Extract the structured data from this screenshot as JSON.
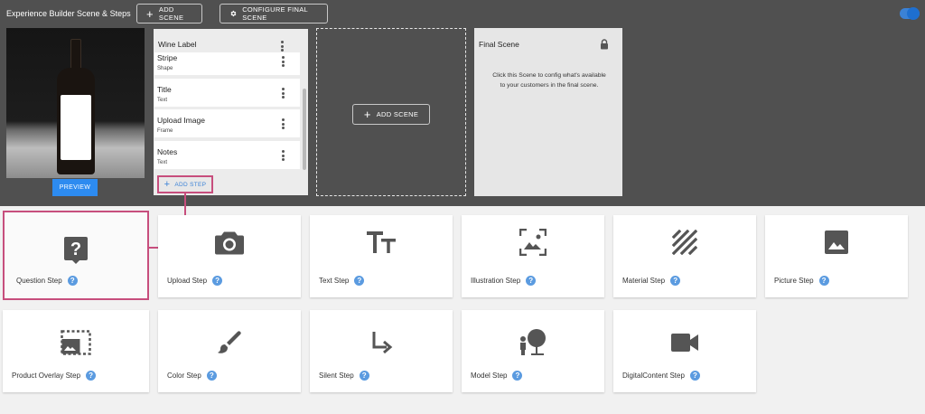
{
  "header": {
    "title": "Experience Builder Scene & Steps",
    "add_scene_label": "ADD SCENE",
    "configure_final_label": "CONFIGURE FINAL SCENE",
    "toggle_on": true
  },
  "preview": {
    "button_label": "PREVIEW"
  },
  "scene": {
    "title": "Wine Label",
    "steps": [
      {
        "name": "Stripe",
        "type": "Shape"
      },
      {
        "name": "Title",
        "type": "Text"
      },
      {
        "name": "Upload Image",
        "type": "Frame"
      },
      {
        "name": "Notes",
        "type": "Text"
      }
    ],
    "add_step_label": "ADD STEP"
  },
  "add_scene_card": {
    "label": "ADD SCENE"
  },
  "final_scene": {
    "title": "Final Scene",
    "description": "Click this Scene to config what's available to your customers in the final scene."
  },
  "step_types": [
    {
      "label": "Question Step",
      "icon": "question-icon"
    },
    {
      "label": "Upload Step",
      "icon": "camera-icon"
    },
    {
      "label": "Text Step",
      "icon": "text-icon"
    },
    {
      "label": "Illustration Step",
      "icon": "illustration-icon"
    },
    {
      "label": "Material Step",
      "icon": "texture-icon"
    },
    {
      "label": "Picture Step",
      "icon": "image-icon"
    },
    {
      "label": "Product Overlay Step",
      "icon": "overlay-icon"
    },
    {
      "label": "Color Step",
      "icon": "brush-icon"
    },
    {
      "label": "Silent Step",
      "icon": "arrow-turn-icon"
    },
    {
      "label": "Model Step",
      "icon": "model-icon"
    },
    {
      "label": "DigitalContent Step",
      "icon": "video-icon"
    }
  ],
  "help_glyph": "?",
  "colors": {
    "accent": "#2d8bf0",
    "highlight": "#c74e7d",
    "dark_bg": "#505050"
  }
}
